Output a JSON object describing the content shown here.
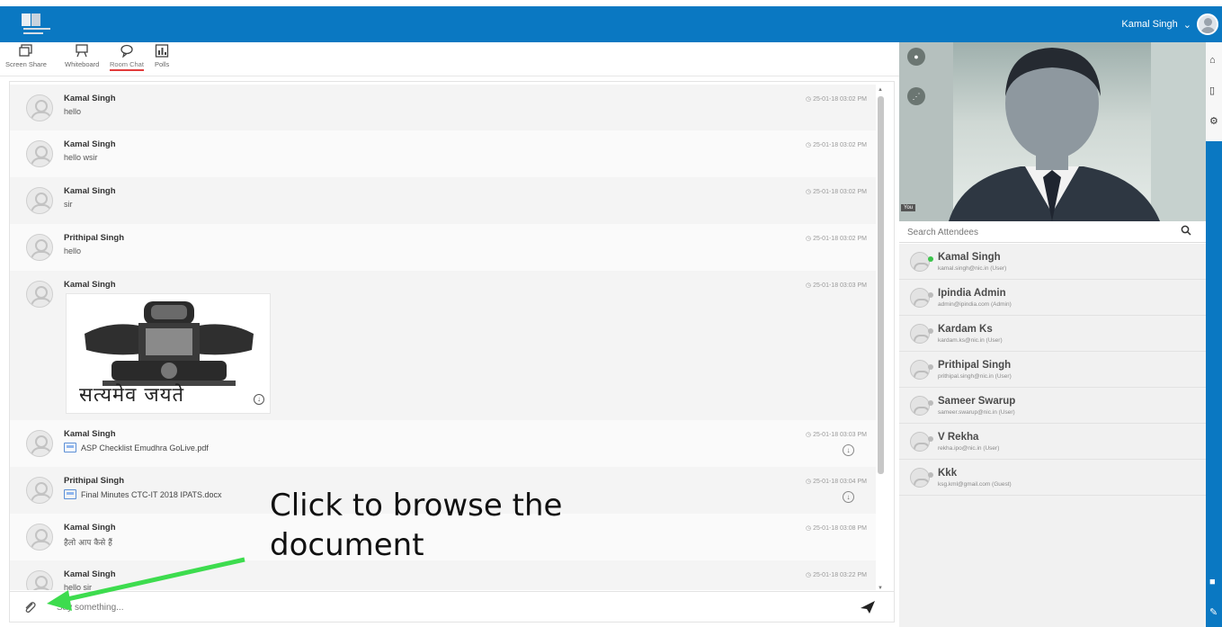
{
  "header": {
    "user_name": "Kamal Singh",
    "caret": "⌄"
  },
  "toolbar": {
    "tabs": [
      {
        "label": "Screen Share",
        "icon": "screen-share-icon"
      },
      {
        "label": "Whiteboard",
        "icon": "whiteboard-icon"
      },
      {
        "label": "Room Chat",
        "icon": "chat-bubble-icon",
        "active": true
      },
      {
        "label": "Polls",
        "icon": "poll-chart-icon"
      }
    ]
  },
  "chat": {
    "messages": [
      {
        "name": "Kamal Singh",
        "text": "hello",
        "time": "25-01-18 03:02 PM"
      },
      {
        "name": "Kamal Singh",
        "text": "hello wsir",
        "time": "25-01-18 03:02 PM"
      },
      {
        "name": "Kamal Singh",
        "text": "sir",
        "time": "25-01-18 03:02 PM"
      },
      {
        "name": "Prithipal Singh",
        "text": "hello",
        "time": "25-01-18 03:02 PM"
      },
      {
        "name": "Kamal Singh",
        "image_caption": "सत्यमेव जयते",
        "time": "25-01-18 03:03 PM"
      },
      {
        "name": "Kamal Singh",
        "file": "ASP Checklist Emudhra GoLive.pdf",
        "time": "25-01-18 03:03 PM"
      },
      {
        "name": "Prithipal Singh",
        "file": "Final Minutes CTC-IT 2018 IPATS.docx",
        "time": "25-01-18 03:04 PM"
      },
      {
        "name": "Kamal Singh",
        "text": "हैलो आप कैसे हैं",
        "time": "25-01-18 03:08 PM"
      },
      {
        "name": "Kamal Singh",
        "text": "hello sir",
        "time": "25-01-18 03:22 PM"
      }
    ],
    "composer_placeholder": "Say something..."
  },
  "video": {
    "self_label": "You"
  },
  "attendees": {
    "search_placeholder": "Search Attendees",
    "list": [
      {
        "name": "Kamal Singh",
        "email": "kamal.singh@nic.in (User)",
        "online": true
      },
      {
        "name": "Ipindia Admin",
        "email": "admin@ipindia.com (Admin)",
        "online": false
      },
      {
        "name": "Kardam Ks",
        "email": "kardam.ks@nic.in (User)",
        "online": false
      },
      {
        "name": "Prithipal Singh",
        "email": "prithipal.singh@nic.in (User)",
        "online": false
      },
      {
        "name": "Sameer Swarup",
        "email": "sameer.swarup@nic.in (User)",
        "online": false
      },
      {
        "name": "V Rekha",
        "email": "rekha.ipo@nic.in (User)",
        "online": false
      },
      {
        "name": "Kkk",
        "email": "ksg.kml@gmail.com (Guest)",
        "online": false
      }
    ]
  },
  "annotation": {
    "line1": "Click to browse the",
    "line2": "document",
    "arrow_color": "#3ddc4e"
  }
}
